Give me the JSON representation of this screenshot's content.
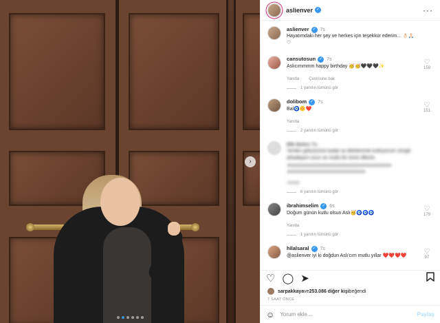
{
  "post": {
    "username": "aslienver",
    "caption_user": "aslienver",
    "caption_time": "7s",
    "caption_text": "Hayatımdaki her şey ve herkes için teşekkür ederim... 👌🏻🙏🏻♡"
  },
  "comments": [
    {
      "user": "cansutosun",
      "time": "7s",
      "text": "Aslıcımmmm happy birthday 🥳🥳🖤🖤🖤✨",
      "likes": "159",
      "reply": "Yanıtla",
      "translate": "Çevirisine bak",
      "view_replies": "1 yanıtın tümünü gör"
    },
    {
      "user": "dolibom",
      "time": "7s",
      "text": "Bal🧿🌼❤️",
      "likes": "151",
      "reply": "Yanıtla",
      "view_replies": "2 yanıtın tümünü gör"
    },
    {
      "user": "Blk Belen 7s",
      "text": "Yerden gökyüzüne kadar iyi dileklerimle kutluyorum sevgili arkadaşım uzun ve mutlu bir ömür dilerim",
      "reply": "Yanıtla",
      "view_replies": "6 yanıtın tümünü gör"
    },
    {
      "user": "ibrahimselim",
      "time": "6s",
      "text": "Doğum günün kutlu olsun Aslı🥳🧿🧿🧿",
      "likes": "179",
      "reply": "Yanıtla",
      "view_replies": "1 yanıtın tümünü gör"
    },
    {
      "user": "hilalsaral",
      "time": "7s",
      "text": "@aslienver iyi ki doğdun Aslı'cım mutlu yıllar ❤️❤️❤️❤️",
      "likes": "97"
    }
  ],
  "likes_line": {
    "user": "sarpakkaya",
    "middle": " ve ",
    "count": "253.086 diğer kişi",
    "suffix": " beğendi"
  },
  "date": "7 SAAT ÖNCE",
  "add_comment": {
    "placeholder": "Yorum ekle...",
    "post_label": "Paylaş"
  },
  "icons": {
    "more": "···",
    "like": "♡",
    "comment": "◯",
    "share": "➤",
    "save": "🔖",
    "emoji": "☺",
    "arrow": "›"
  },
  "carousel": {
    "active_index": 1,
    "count": 6
  }
}
